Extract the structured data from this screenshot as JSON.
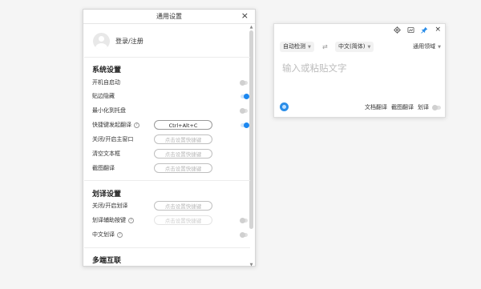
{
  "settings": {
    "title": "通用设置",
    "close": "×",
    "login_label": "登录/注册",
    "sections": [
      {
        "heading": "系统设置",
        "rows": [
          {
            "label": "开机自启动",
            "control": "toggle",
            "state": "off"
          },
          {
            "label": "贴边隐藏",
            "control": "toggle",
            "state": "on"
          },
          {
            "label": "最小化到托盘",
            "control": "toggle",
            "state": "off"
          },
          {
            "label": "快捷键发起翻译",
            "info": true,
            "control": "hotkey+toggle",
            "value": "Ctrl+Alt+C",
            "state": "on"
          },
          {
            "label": "关闭/开启主窗口",
            "control": "hotkey",
            "value": "点击设置快捷键"
          },
          {
            "label": "清空文本框",
            "control": "hotkey",
            "value": "点击设置快捷键"
          },
          {
            "label": "截图翻译",
            "control": "hotkey",
            "value": "点击设置快捷键"
          }
        ]
      },
      {
        "heading": "划译设置",
        "rows": [
          {
            "label": "关闭/开启划译",
            "control": "hotkey",
            "value": "点击设置快捷键"
          },
          {
            "label": "划译辅助按键",
            "info": true,
            "control": "hotkey-disabled+toggle",
            "value": "点击设置快捷键",
            "state": "off"
          },
          {
            "label": "中文划译",
            "info": true,
            "control": "toggle",
            "state": "off"
          }
        ]
      },
      {
        "heading": "多端互联",
        "rows": []
      }
    ]
  },
  "translator": {
    "icons": [
      "settings-icon",
      "screenshot-icon",
      "pin-icon"
    ],
    "close": "×",
    "source_lang": "自动检测",
    "swap": "⇄",
    "target_lang": "中文(简体)",
    "domain": "通用领域",
    "input_placeholder": "输入或粘贴文字",
    "actions": {
      "doc_translate": "文档翻译",
      "screenshot_translate": "截图翻译",
      "select_translate": "划译"
    }
  },
  "colors": {
    "accent": "#1b87f0",
    "toggle_off": "#d0d0d0",
    "placeholder": "#bdbdbd"
  }
}
